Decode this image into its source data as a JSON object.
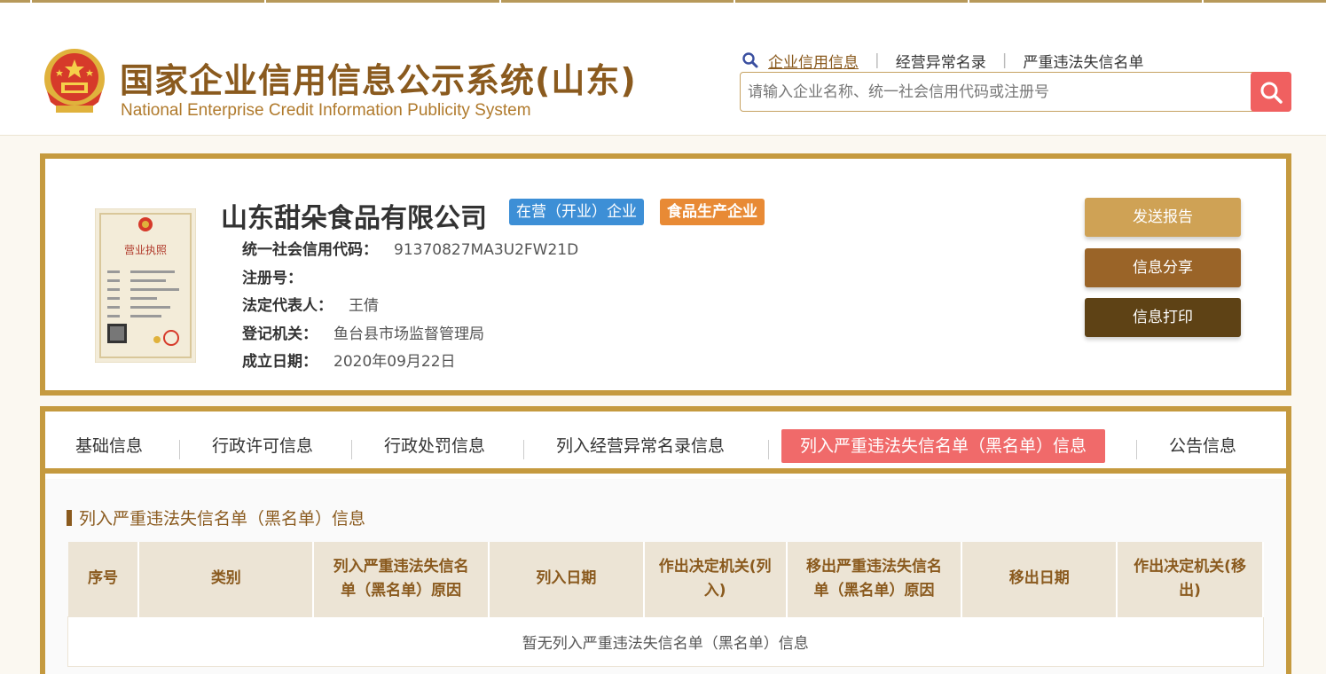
{
  "site": {
    "title_cn": "国家企业信用信息公示系统(山东)",
    "title_en": "National Enterprise Credit Information Publicity System"
  },
  "topnav": {
    "items": [
      {
        "label": "企业信用信息",
        "active": true
      },
      {
        "label": "经营异常名录",
        "active": false
      },
      {
        "label": "严重违法失信名单",
        "active": false
      }
    ],
    "separator": "|"
  },
  "search": {
    "placeholder": "请输入企业名称、统一社会信用代码或注册号",
    "value": ""
  },
  "company": {
    "name": "山东甜朵食品有限公司",
    "status_badge": "在营（开业）企业",
    "type_badge": "食品生产企业",
    "fields": {
      "credit_code_label": "统一社会信用代码：",
      "credit_code": "91370827MA3U2FW21D",
      "reg_no_label": "注册号：",
      "reg_no": "",
      "legal_rep_label": "法定代表人：",
      "legal_rep": "王倩",
      "authority_label": "登记机关：",
      "authority": "鱼台县市场监督管理局",
      "founded_label": "成立日期：",
      "founded": "2020年09月22日"
    },
    "license_title": "营业执照"
  },
  "actions": {
    "send_report": "发送报告",
    "share": "信息分享",
    "print": "信息打印"
  },
  "tabs": [
    {
      "label": "基础信息",
      "active": false
    },
    {
      "label": "行政许可信息",
      "active": false
    },
    {
      "label": "行政处罚信息",
      "active": false
    },
    {
      "label": "列入经营异常名录信息",
      "active": false
    },
    {
      "label": "列入严重违法失信名单（黑名单）信息",
      "active": true
    },
    {
      "label": "公告信息",
      "active": false
    }
  ],
  "section": {
    "title": "列入严重违法失信名单（黑名单）信息",
    "table": {
      "headers": [
        "序号",
        "类别",
        "列入严重违法失信名单（黑名单）原因",
        "列入日期",
        "作出决定机关(列入)",
        "移出严重违法失信名单（黑名单）原因",
        "移出日期",
        "作出决定机关(移出)"
      ],
      "empty_message": "暂无列入严重违法失信名单（黑名单）信息"
    }
  },
  "colors": {
    "gold": "#c59a3f",
    "brown_text": "#8a5a1e",
    "active_tab": "#f06a6a",
    "status_blue": "#3d8fd6",
    "type_orange": "#e88a35"
  },
  "icons": {
    "topnav_search": "search-icon",
    "search_button": "search-icon",
    "emblem": "national-emblem-icon"
  }
}
